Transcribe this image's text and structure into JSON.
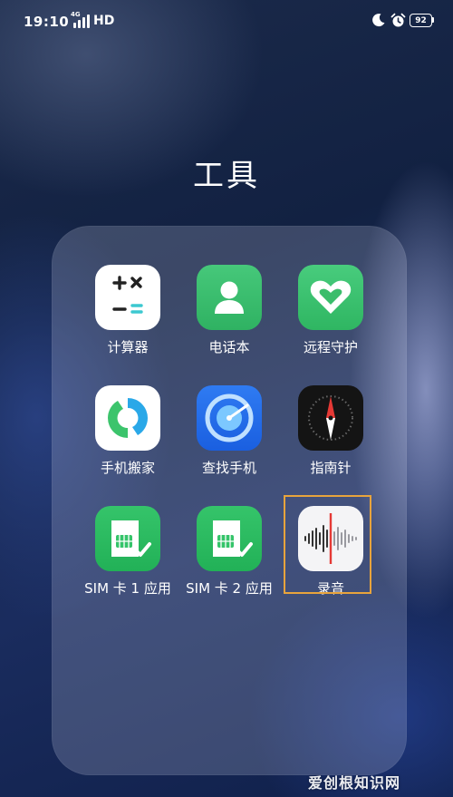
{
  "status_bar": {
    "time": "19:10",
    "network": "4G",
    "hd": "HD",
    "battery": "92"
  },
  "folder": {
    "title": "工具",
    "apps": [
      {
        "name": "calculator",
        "label": "计算器",
        "icon": "calculator-icon"
      },
      {
        "name": "contacts",
        "label": "电话本",
        "icon": "contacts-icon"
      },
      {
        "name": "remote-guard",
        "label": "远程守护",
        "icon": "heart-icon"
      },
      {
        "name": "phone-clone",
        "label": "手机搬家",
        "icon": "transfer-icon"
      },
      {
        "name": "find-phone",
        "label": "查找手机",
        "icon": "radar-icon"
      },
      {
        "name": "compass",
        "label": "指南针",
        "icon": "compass-icon"
      },
      {
        "name": "sim1",
        "label": "SIM 卡 1 应用",
        "icon": "sim-card-icon"
      },
      {
        "name": "sim2",
        "label": "SIM 卡 2 应用",
        "icon": "sim-card-icon"
      },
      {
        "name": "recorder",
        "label": "录音",
        "icon": "waveform-icon"
      }
    ]
  },
  "watermark": "爱创根知识网",
  "colors": {
    "accent_green": "#2fb65d",
    "highlight_border": "#e8a43c"
  }
}
